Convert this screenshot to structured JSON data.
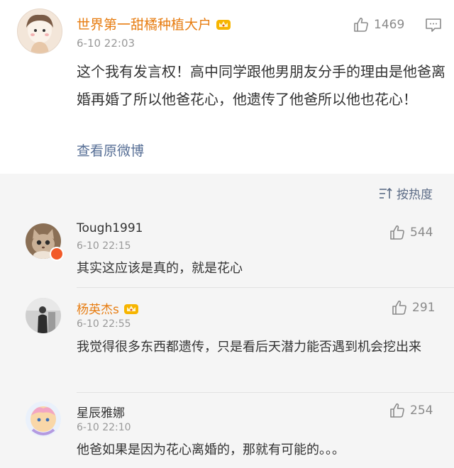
{
  "post": {
    "username": "世界第一甜橘种植大户",
    "time": "6-10 22:03",
    "likes": "1469",
    "text": "这个我有发言权！高中同学跟他男朋友分手的理由是他爸离婚再婚了所以他爸花心，他遗传了他爸所以他也花心！",
    "view_original": "查看原微博"
  },
  "sort": {
    "label": "按热度",
    "icon": "sort-icon"
  },
  "comments": [
    {
      "username": "Tough1991",
      "time": "6-10 22:15",
      "likes": "544",
      "text": "其实这应该是真的，就是花心"
    },
    {
      "username": "杨英杰s",
      "time": "6-10 22:55",
      "likes": "291",
      "text": "我觉得很多东西都遗传，只是看后天潜力能否遇到机会挖出来"
    },
    {
      "username": "星辰雅娜",
      "time": "6-10 22:10",
      "likes": "254",
      "text": "他爸如果是因为花心离婚的，那就有可能的。。。"
    }
  ],
  "colors": {
    "vip_name": "#e77d12",
    "link": "#566e95",
    "text": "#333333",
    "meta": "#999999"
  }
}
